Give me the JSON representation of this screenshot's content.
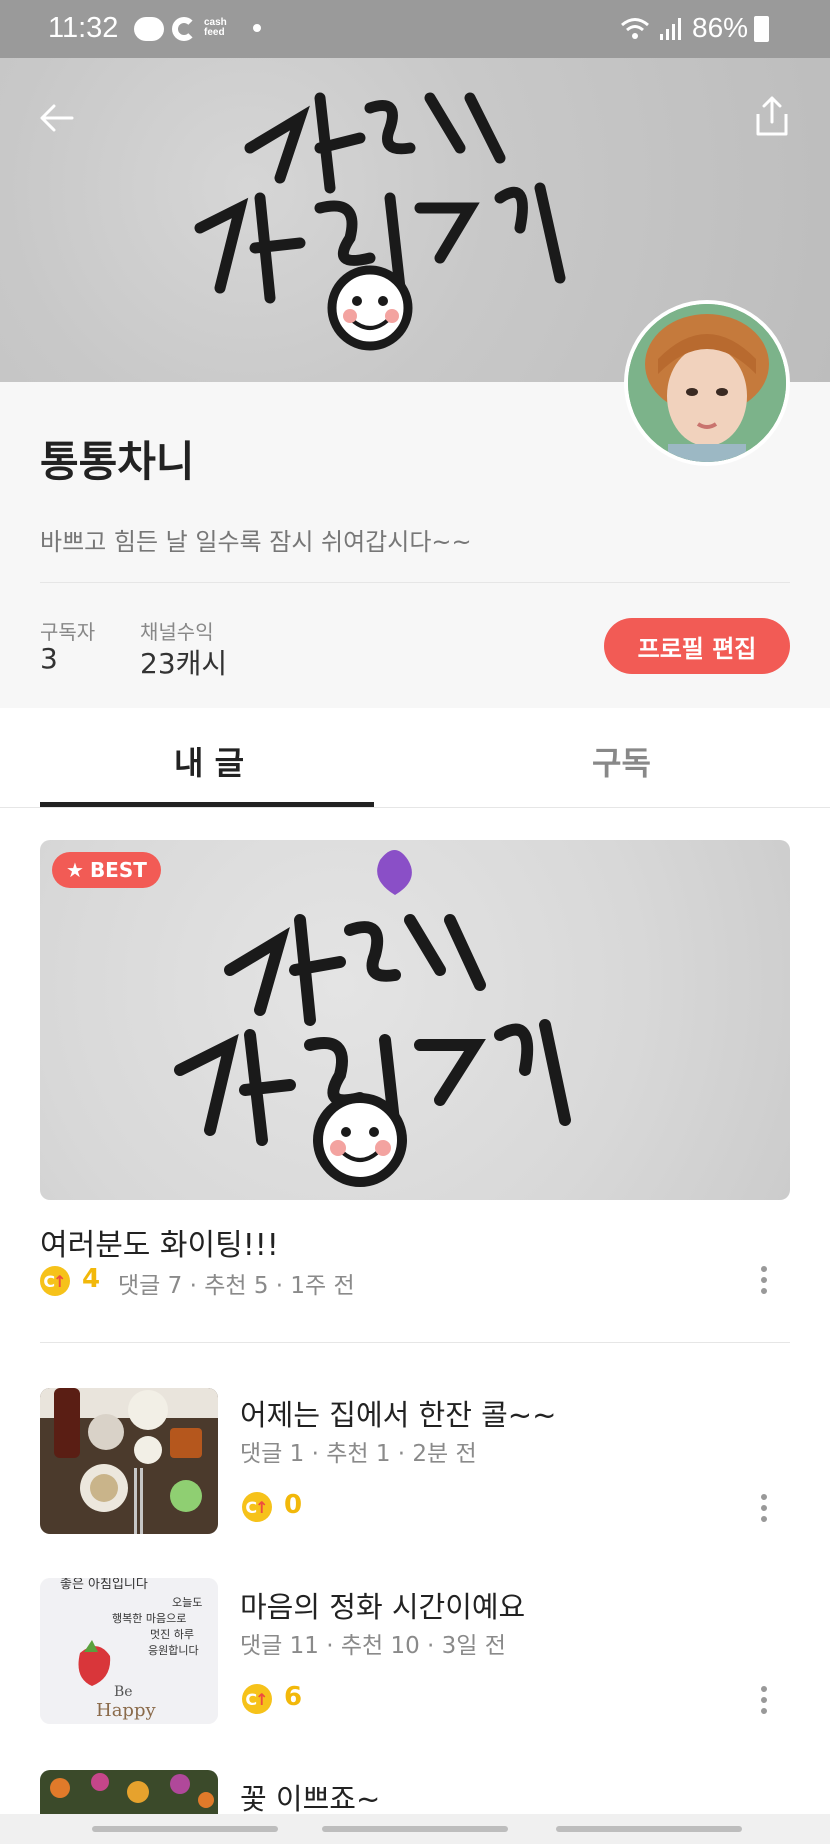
{
  "status_bar": {
    "time": "11:32",
    "cash_line1": "cash",
    "cash_line2": "feed",
    "battery": "86%"
  },
  "profile": {
    "nickname": "통통차니",
    "bio": "바쁘고 힘든 날 일수록 잠시 쉬여갑시다~~",
    "subscribers_label": "구독자",
    "subscribers_value": "3",
    "revenue_label": "채널수익",
    "revenue_value": "23캐시",
    "edit_button": "프로필 편집"
  },
  "tabs": [
    {
      "label": "내 글",
      "active": true
    },
    {
      "label": "구독",
      "active": false
    }
  ],
  "best_post": {
    "badge": "BEST",
    "title": "여러분도 화이팅!!!",
    "coin_value": "4",
    "meta": "댓글 7 · 추천 5 · 1주 전"
  },
  "posts": [
    {
      "title": "어제는 집에서 한잔 콜~~",
      "meta": "댓글 1 · 추천 1 · 2분 전",
      "coin_value": "0"
    },
    {
      "title": "마음의 정화 시간이예요",
      "meta": "댓글 11 · 추천 10 · 3일 전",
      "coin_value": "6"
    },
    {
      "title": "꽃 이쁘죠~"
    }
  ],
  "thumbnail_text": {
    "line1": "좋은 아침입니다",
    "line2": "오늘도",
    "line3": "행복한 마음으로",
    "line4": "멋진 하루",
    "line5": "응원합니다",
    "line6": "Be",
    "line7": "Happy"
  },
  "colors": {
    "accent_red": "#f25b55",
    "coin_yellow": "#f6c21a",
    "coin_text": "#f2b80a"
  },
  "icons": {
    "back": "back-arrow-icon",
    "share": "share-icon",
    "coin": "cash-coin-icon",
    "more": "more-vertical-icon"
  }
}
